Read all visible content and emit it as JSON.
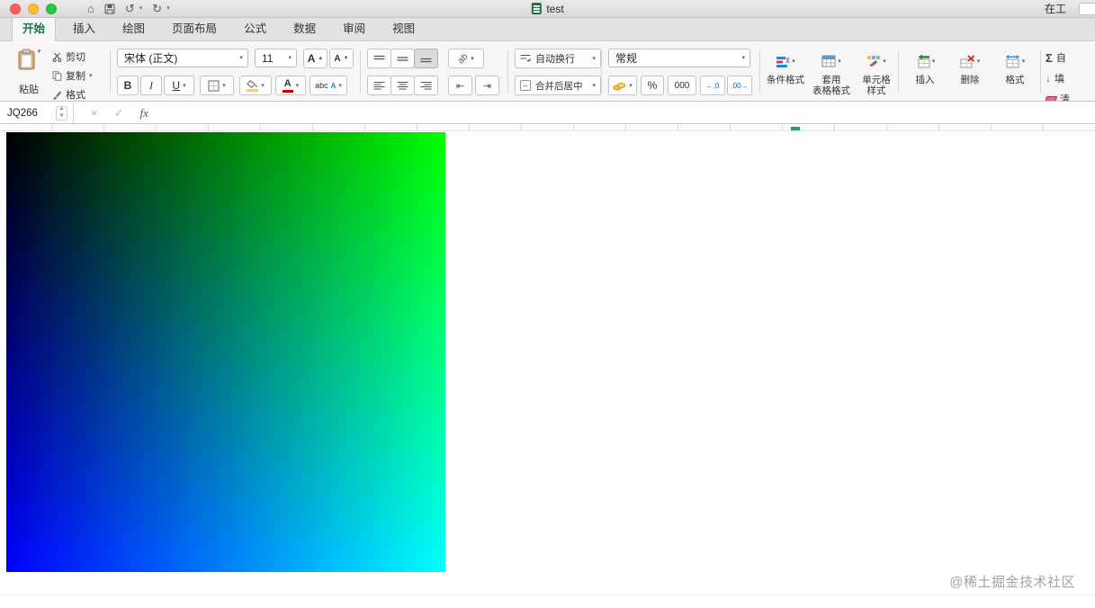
{
  "titlebar": {
    "title": "test",
    "right_text": "在工"
  },
  "tabs": [
    {
      "label": "开始",
      "active": true
    },
    {
      "label": "插入",
      "active": false
    },
    {
      "label": "绘图",
      "active": false
    },
    {
      "label": "页面布局",
      "active": false
    },
    {
      "label": "公式",
      "active": false
    },
    {
      "label": "数据",
      "active": false
    },
    {
      "label": "审阅",
      "active": false
    },
    {
      "label": "视图",
      "active": false
    }
  ],
  "ribbon": {
    "clipboard": {
      "paste": "粘贴",
      "cut": "剪切",
      "copy": "复制",
      "format_painter": "格式"
    },
    "font": {
      "family": "宋体 (正文)",
      "size": "11",
      "bold": "B",
      "italic": "I",
      "underline": "U",
      "grow": "A",
      "shrink": "A",
      "color_letter": "A",
      "phonetic": "abc",
      "phonetic_sub": "A"
    },
    "alignment": {
      "wrap_text": "自动换行",
      "merge_center": "合并后居中"
    },
    "number": {
      "format": "常规",
      "percent": "%",
      "thousands": "000",
      "increase_decimal": "←.0",
      "decrease_decimal": ".00→"
    },
    "styles": {
      "conditional_format": "条件格式",
      "format_as_table_line1": "套用",
      "format_as_table_line2": "表格格式",
      "cell_styles_line1": "单元格",
      "cell_styles_line2": "样式"
    },
    "cells": {
      "insert": "插入",
      "delete": "删除",
      "format": "格式"
    },
    "editing": {
      "sigma": "Σ",
      "autosum": "自",
      "fill": "填",
      "clear": "清"
    }
  },
  "formula_bar": {
    "name_box": "JQ266",
    "fx_label": "fx"
  },
  "canvas": {
    "watermark": "@稀土掘金技术社区",
    "gradient": {
      "top_left": "#000000",
      "top_right": "#00ff00",
      "bottom_left": "#0000ff",
      "bottom_right": "#00ffff"
    }
  },
  "icons": {
    "home": "⌂",
    "undo": "↺",
    "redo": "↻",
    "chevron_down": "▾",
    "up_small": "▲",
    "down_small": "▼",
    "merge_arrows": "↔",
    "indent_decrease": "⇤",
    "indent_increase": "⇥",
    "fill_down": "↓",
    "cancel": "×",
    "enter": "✓",
    "orientation": "ab"
  },
  "colors": {
    "active_tab_green": "#1e7145",
    "excel_green": "#217346",
    "traffic_red": "#ff5f57",
    "traffic_yellow": "#febc2e",
    "traffic_green": "#28c840"
  }
}
